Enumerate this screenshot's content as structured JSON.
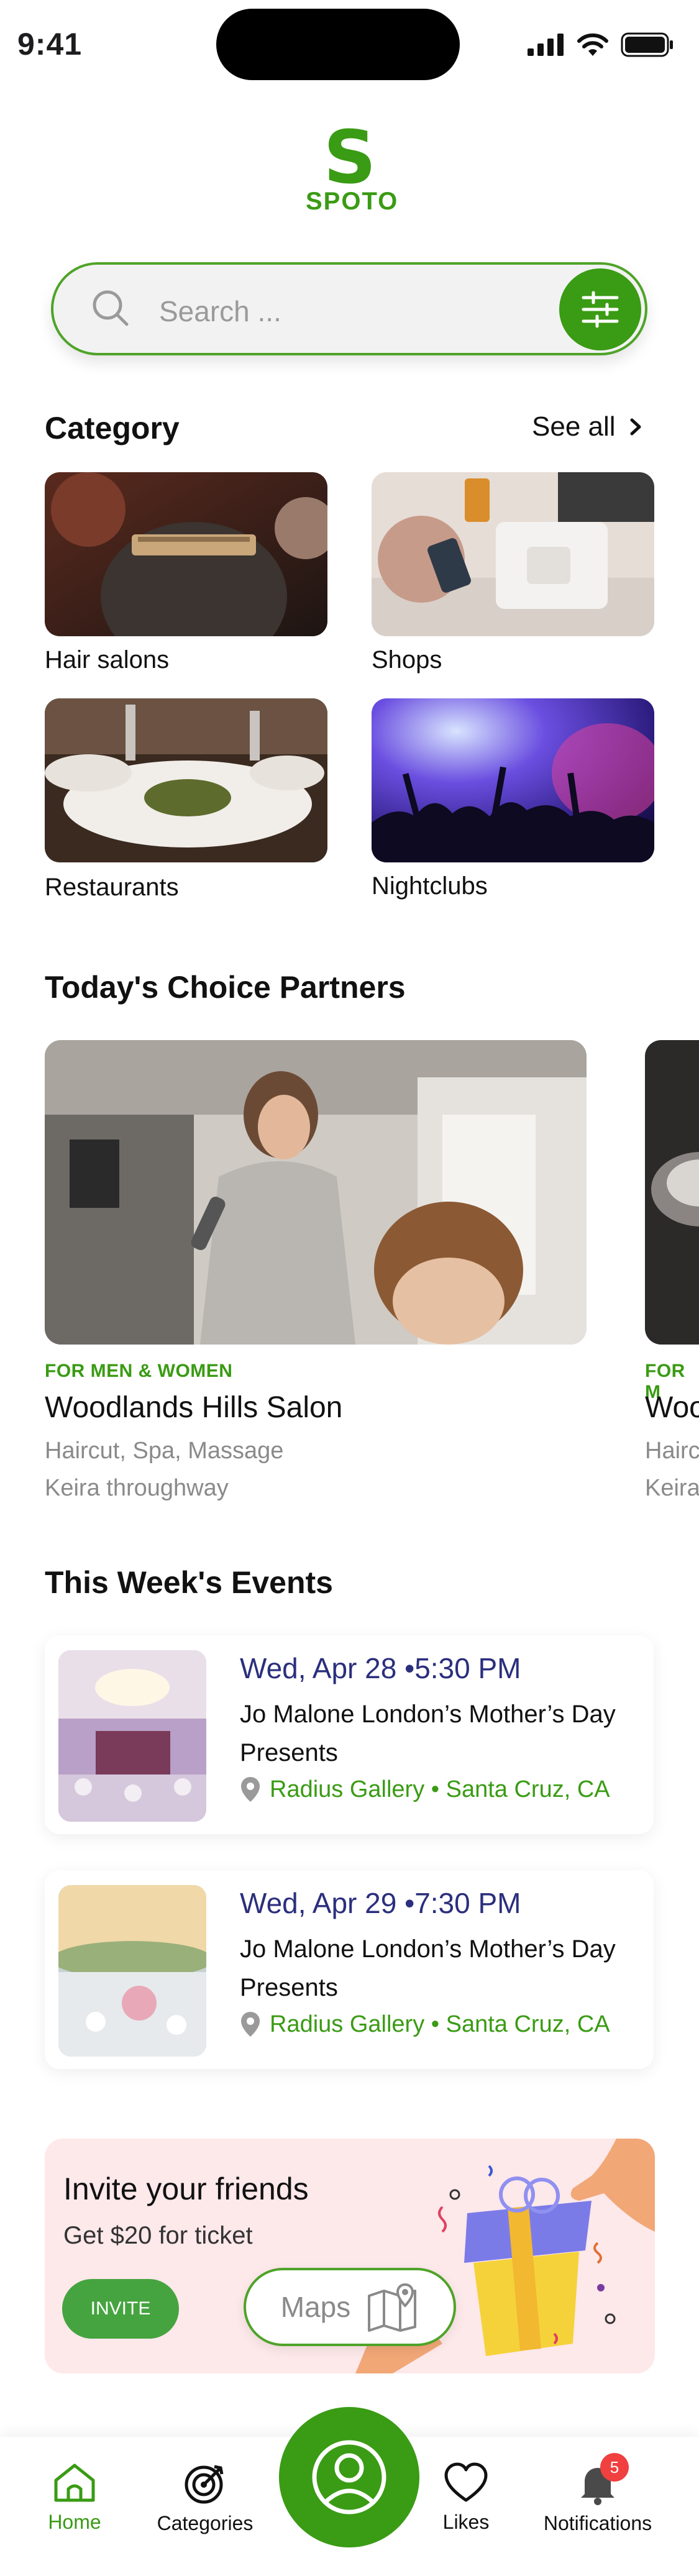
{
  "status_bar": {
    "time": "9:41"
  },
  "logo": {
    "mark": "S",
    "word": "SPOTO",
    "brand_color": "#3a9b14"
  },
  "search": {
    "placeholder": "Search ..."
  },
  "category": {
    "title": "Category",
    "see_all": "See all",
    "items": [
      {
        "label": "Hair salons"
      },
      {
        "label": "Shops"
      },
      {
        "label": "Restaurants"
      },
      {
        "label": "Nightclubs"
      }
    ]
  },
  "partners": {
    "title": "Today's Choice Partners",
    "items": [
      {
        "tag": "FOR MEN & WOMEN",
        "name": "Woodlands Hills Salon",
        "services": "Haircut, Spa, Massage",
        "address": "Keira throughway"
      },
      {
        "tag": "FOR M",
        "name": "Woo",
        "services": "Hairc",
        "address": "Keira"
      }
    ]
  },
  "events": {
    "title": "This Week's Events",
    "items": [
      {
        "date": "Wed, Apr 28 •5:30 PM",
        "title": "Jo Malone London’s Mother’s Day Presents",
        "location": "Radius Gallery • Santa Cruz, CA"
      },
      {
        "date": "Wed, Apr 29 •7:30 PM",
        "title": "Jo Malone London’s Mother’s Day Presents",
        "location": "Radius Gallery • Santa Cruz, CA"
      }
    ]
  },
  "invite": {
    "title": "Invite your friends",
    "subtitle": "Get $20 for ticket",
    "button": "INVITE"
  },
  "maps_button": {
    "label": "Maps"
  },
  "tabbar": {
    "items": [
      {
        "label": "Home",
        "active": true
      },
      {
        "label": "Categories"
      },
      {
        "label": "Likes"
      },
      {
        "label": "Notifications"
      }
    ],
    "notification_count": "5"
  }
}
